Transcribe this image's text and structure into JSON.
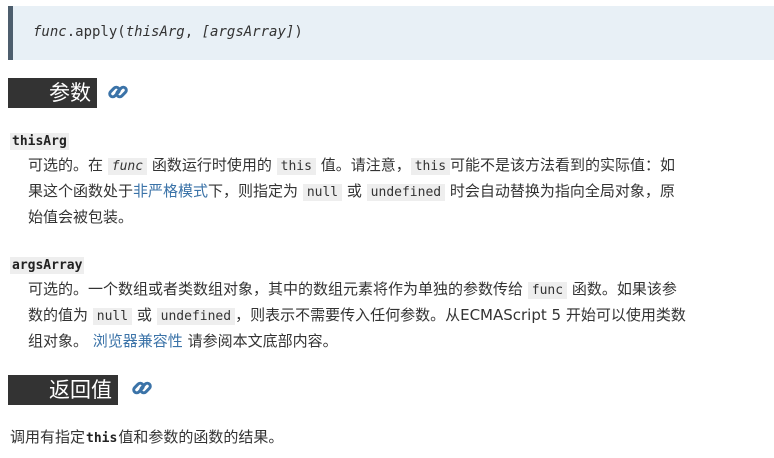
{
  "syntax": {
    "func": "func",
    "apply": ".apply(",
    "thisArg": "thisArg",
    "sep": ", ",
    "argsArray": "[argsArray]",
    "close": ")"
  },
  "params_heading": "参数",
  "thisArg": {
    "term": "thisArg",
    "d1": "可选的。在 ",
    "c_func": "func",
    "d2": " 函数运行时使用的 ",
    "c_this": "this",
    "d3": " 值。请注意，",
    "c_this2": "this",
    "d4": "可能不是该方法看到的实际值：如果这个函数处于",
    "link_strict": "非严格模式",
    "d5": "下，则指定为 ",
    "c_null": "null",
    "d6": " 或 ",
    "c_undefined": "undefined",
    "d7": " 时会自动替换为指向全局对象，原始值会被包装。"
  },
  "argsArray": {
    "term": "argsArray",
    "d1": "可选的。一个数组或者类数组对象，其中的数组元素将作为单独的参数传给 ",
    "c_func": "func",
    "d2": " 函数。如果该参数的值为 ",
    "c_null": "null",
    "d3": " 或 ",
    "c_undefined": "undefined",
    "d4": "，则表示不需要传入任何参数。从ECMAScript 5 开始可以使用类数组对象。 ",
    "link_compat": "浏览器兼容性",
    "d5": " 请参阅本文底部内容。"
  },
  "return_heading": "返回值",
  "return_text": {
    "t1": "调用有指定",
    "c_this": "this",
    "t2": "值和参数的函数的结果。"
  },
  "colors": {
    "heading_bg": "#333333",
    "link": "#3b73a8",
    "syntax_bg": "#e8f0f6",
    "syntax_border": "#4d5e6d"
  }
}
